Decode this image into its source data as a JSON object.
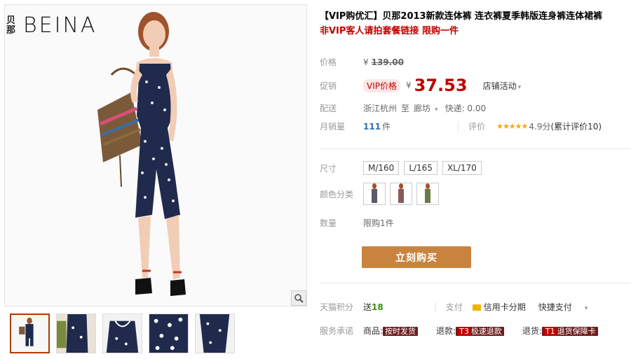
{
  "brand": {
    "logo_cn": "贝那",
    "logo_en": "BEINA"
  },
  "gallery": {
    "zoom_icon": "magnifier-icon",
    "thumbnails": [
      "full-body-front",
      "top-front",
      "neckline-closeup",
      "fabric-print",
      "pants-print"
    ]
  },
  "product": {
    "title": "【VIP购优汇】贝那2013新款连体裤 连衣裤夏季韩版连身裤连体裙裤",
    "subtitle": "非VIP客人请拍套餐链接 限购一件"
  },
  "price": {
    "label": "价格",
    "currency": "¥",
    "original": "139.00"
  },
  "promo": {
    "label": "促销",
    "vip_tag": "VIP价格",
    "currency": "¥",
    "price": "37.53",
    "activity_dropdown": "店铺活动"
  },
  "delivery": {
    "label": "配送",
    "from": "浙江杭州",
    "to_word": "至",
    "to": "廊坊",
    "shipping": "快递: 0.00"
  },
  "sales": {
    "label": "月销量",
    "count": "111",
    "unit": "件",
    "rating_label": "评价",
    "stars": "★★★★★",
    "score": "4.9分",
    "total_reviews": "(累计评价10)"
  },
  "sizes": {
    "label": "尺寸",
    "options": [
      "M/160",
      "L/165",
      "XL/170"
    ]
  },
  "colors": {
    "label": "颜色分类",
    "options": [
      "color-1",
      "color-2",
      "color-3"
    ]
  },
  "quantity": {
    "label": "数量",
    "limit_text": "限购1件"
  },
  "buy_button": {
    "label": "立刻购买"
  },
  "points": {
    "label": "天猫积分",
    "text_prefix": "送",
    "value": "18",
    "pay_label": "支付",
    "pay_option1": "信用卡分期",
    "pay_option2": "快捷支付"
  },
  "services": {
    "label": "服务承诺",
    "item1_prefix": "商品:",
    "item1_tag": "按时发货",
    "item2_prefix": "退款:",
    "item2_code": "T3",
    "item2_tag": "极速退款",
    "item3_prefix": "退货:",
    "item3_code": "T1",
    "item3_tag": "退货保障卡"
  },
  "colors_theme": {
    "accent": "#c40000",
    "button": "#c8843e",
    "link": "#2c71b3",
    "points": "#3a8f13"
  }
}
